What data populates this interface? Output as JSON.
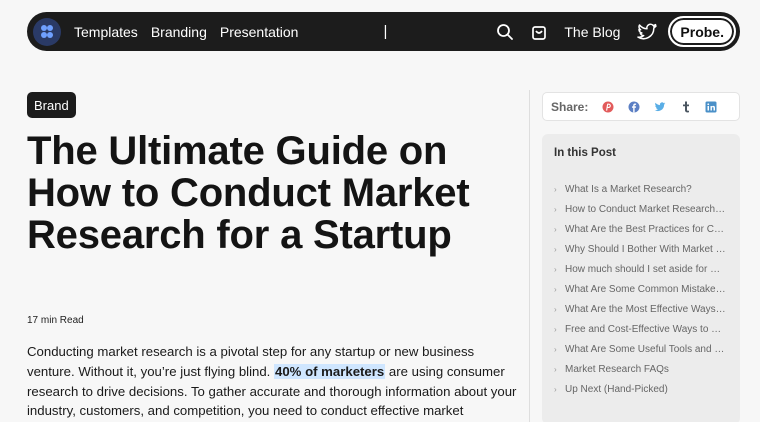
{
  "nav": {
    "links": [
      "Templates",
      "Branding",
      "Presentation"
    ],
    "caret": "|",
    "blog": "The Blog",
    "cta": "Probe."
  },
  "article": {
    "tag": "Brand",
    "title": "The Ultimate Guide on How to Conduct Market Research for a Startup",
    "read_time": "17 min Read",
    "intro_before": "Conducting market research is a pivotal step for any startup or new business venture. Without it, you’re just flying blind. ",
    "intro_highlight": "40% of marketers",
    "intro_after": " are using consumer research to drive decisions. To gather accurate and thorough information about your industry, customers, and competition, you need to conduct effective market"
  },
  "share": {
    "label": "Share:",
    "icons": [
      {
        "name": "pinterest-icon",
        "color": "#e25b5b"
      },
      {
        "name": "facebook-icon",
        "color": "#5b7fc4"
      },
      {
        "name": "twitter-icon",
        "color": "#5aaee6"
      },
      {
        "name": "tumblr-icon",
        "color": "#4a5560"
      },
      {
        "name": "linkedin-icon",
        "color": "#4a90c8"
      }
    ]
  },
  "toc": {
    "title": "In this Post",
    "items": [
      "What Is a Market Research?",
      "How to Conduct Market Research for a Startup",
      "What Are the Best Practices for Conducting Market Research",
      "Why Should I Bother With Market Research",
      "How much should I set aside for market research",
      "What Are Some Common Mistakes in Market Research",
      "What Are the Most Effective Ways to Conduct Research",
      "Free and Cost-Effective Ways to Do Market Research",
      "What Are Some Useful Tools and Resources",
      "Market Research FAQs",
      "Up Next (Hand-Picked)"
    ]
  },
  "colors": {
    "nav_bg": "#1c1c1c",
    "highlight": "#cfe6ff",
    "sidebar_bg": "#ececec"
  }
}
